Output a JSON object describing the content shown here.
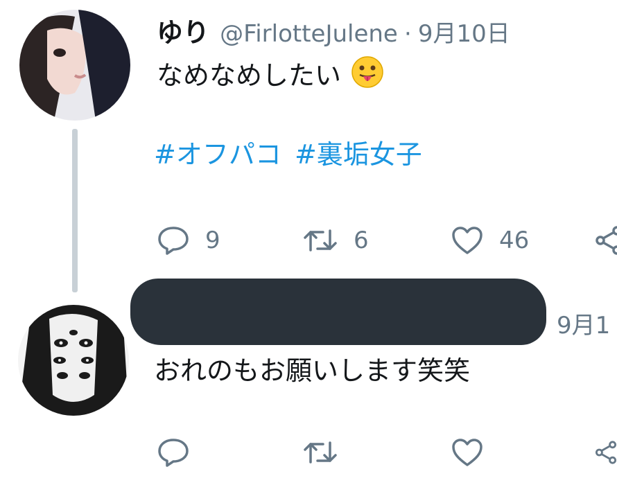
{
  "tweets": [
    {
      "name": "ゆり",
      "handle": "@FirlotteJulene",
      "separator": "·",
      "date": "9月10日",
      "text": "なめなめしたい",
      "emoji": "tongue-out-face",
      "hashtags": [
        "#オフパコ",
        "#裏垢女子"
      ],
      "reply_count": "9",
      "retweet_count": "6",
      "like_count": "46"
    },
    {
      "name_redacted": true,
      "date": "9月1",
      "text": "おれのもお願いします笑笑"
    }
  ],
  "icons": {
    "reply": "reply-icon",
    "retweet": "retweet-icon",
    "like": "heart-icon",
    "share": "share-icon"
  },
  "colors": {
    "hashtag": "#1b95e0",
    "secondary_text": "#657786",
    "thread_line": "#c8d0d6"
  }
}
